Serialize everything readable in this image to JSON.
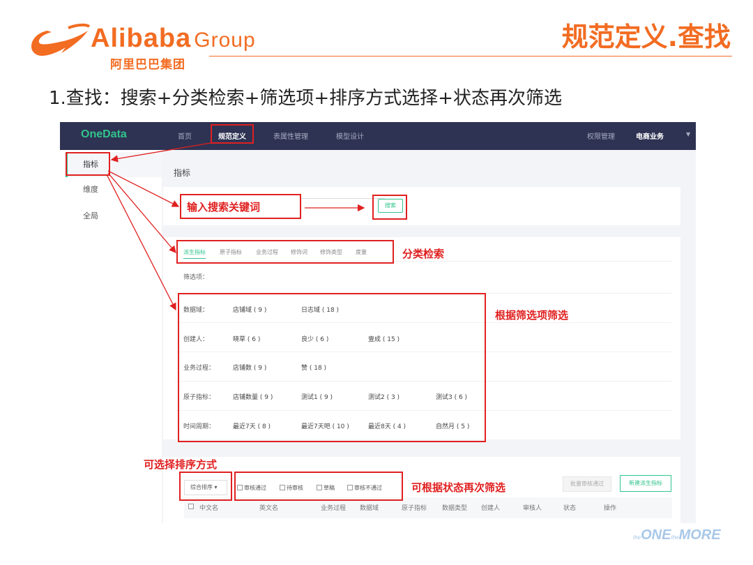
{
  "slide": {
    "logo_en": "Alibaba",
    "logo_group": "Group",
    "logo_cn": "阿里巴巴集团",
    "title": "规范定义.查找",
    "subtitle": "1.查找：搜索+分类检索+筛选项+排序方式选择+状态再次筛选",
    "watermark_pre": "the",
    "watermark_one": "ONE",
    "watermark_mid": "the",
    "watermark_more": "MORE"
  },
  "app": {
    "brand": "OneData",
    "nav": [
      "首页",
      "规范定义",
      "表属性管理",
      "模型设计"
    ],
    "nav_active_index": 1,
    "nav_right": [
      "权限管理",
      "电商业务"
    ],
    "sidebar": [
      "指标",
      "维度",
      "全局"
    ],
    "main_title": "指标",
    "search_button": "搜索",
    "tabs": [
      "派生指标",
      "原子指标",
      "业务过程",
      "修饰词",
      "修饰类型",
      "度量"
    ],
    "filter_label": "筛选项：",
    "filters": [
      {
        "label": "数据域：",
        "options": [
          "店铺域 ( 9 )",
          "日志域 ( 18 )"
        ]
      },
      {
        "label": "创建人：",
        "options": [
          "晓草 ( 6 )",
          "良少 ( 6 )",
          "壹成 ( 15 )"
        ]
      },
      {
        "label": "业务过程：",
        "options": [
          "店铺数 ( 9 )",
          "赞 ( 18 )"
        ]
      },
      {
        "label": "原子指标：",
        "options": [
          "店铺数量 ( 9 )",
          "测试1 ( 9 )",
          "测试2 ( 3 )",
          "测试3 ( 6 )"
        ]
      },
      {
        "label": "时间周期：",
        "options": [
          "最近7天 ( 8 )",
          "最近7天吧 ( 10 )",
          "最近8天 ( 4 )",
          "自然月 ( 5 )"
        ]
      }
    ],
    "sort_select": "综合排序 ▾",
    "status_options": [
      "审核通过",
      "待审核",
      "草稿",
      "审核不通过"
    ],
    "batch_button": "批量审核通过",
    "new_button": "新建派生指标",
    "table_headers": [
      "中文名",
      "英文名",
      "业务过程",
      "数据域",
      "原子指标",
      "数据类型",
      "创建人",
      "审核人",
      "状态",
      "操作"
    ]
  },
  "annotations": {
    "search_hint": "输入搜索关键词",
    "category_hint": "分类检索",
    "filter_hint": "根据筛选项筛选",
    "sort_hint": "可选择排序方式",
    "status_hint": "可根据状态再次筛选"
  },
  "colors": {
    "accent_orange": "#f26c22",
    "annotation_red": "#e02020",
    "topbar": "#2e3353",
    "brand_green": "#32c48d"
  }
}
